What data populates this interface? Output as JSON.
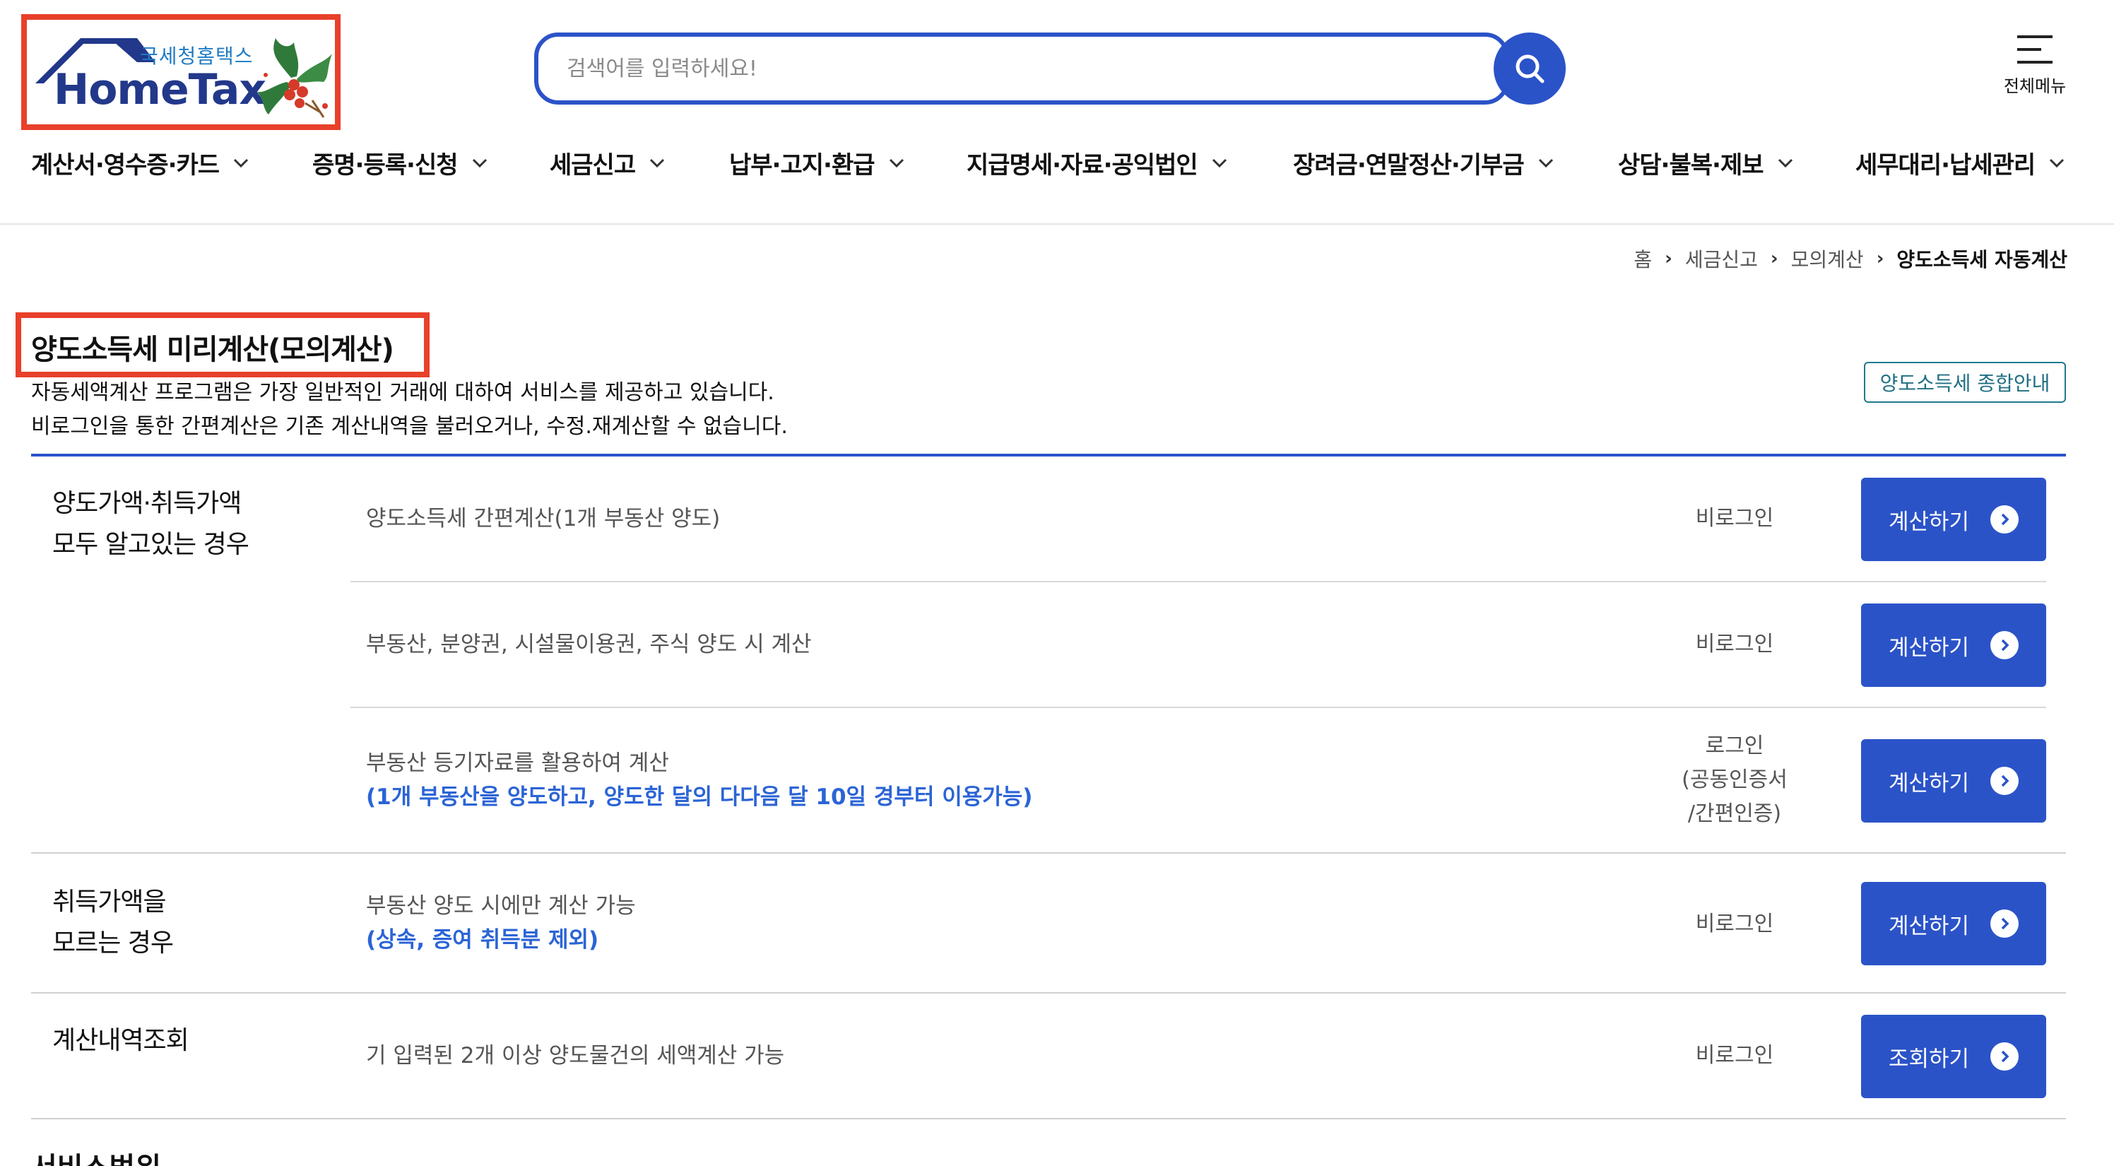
{
  "header": {
    "logo": {
      "subtitle": "국세청홈택스",
      "title": "HomeTax"
    },
    "search": {
      "placeholder": "검색어를 입력하세요!"
    },
    "menu_label": "전체메뉴",
    "nav": [
      {
        "label": "계산서·영수증·카드"
      },
      {
        "label": "증명·등록·신청"
      },
      {
        "label": "세금신고"
      },
      {
        "label": "납부·고지·환급"
      },
      {
        "label": "지급명세·자료·공익법인"
      },
      {
        "label": "장려금·연말정산·기부금"
      },
      {
        "label": "상담·불복·제보"
      },
      {
        "label": "세무대리·납세관리"
      }
    ]
  },
  "breadcrumb": {
    "items": [
      "홈",
      "세금신고",
      "모의계산"
    ],
    "current": "양도소득세 자동계산"
  },
  "page": {
    "title": "양도소득세 미리계산(모의계산)",
    "desc1": "자동세액계산 프로그램은 가장 일반적인 거래에 대하여 서비스를 제공하고 있습니다.",
    "desc2": "비로그인을 통한 간편계산은 기존 계산내역을 불러오거나, 수정.재계산할 수 없습니다.",
    "guide_button": "양도소득세 종합안내"
  },
  "groups": [
    {
      "label_lines": [
        "양도가액·취득가액",
        "모두 알고있는 경우"
      ],
      "items": [
        {
          "desc": "양도소득세 간편계산(1개 부동산 양도)",
          "note": "",
          "login": [
            "비로그인"
          ],
          "button": "계산하기"
        },
        {
          "desc": "부동산, 분양권, 시설물이용권, 주식 양도 시 계산",
          "note": "",
          "login": [
            "비로그인"
          ],
          "button": "계산하기"
        },
        {
          "desc": "부동산 등기자료를 활용하여 계산",
          "note": "(1개 부동산을 양도하고, 양도한 달의 다다음 달 10일 경부터 이용가능)",
          "login": [
            "로그인",
            "(공동인증서",
            "/간편인증)"
          ],
          "button": "계산하기"
        }
      ]
    },
    {
      "label_lines": [
        "취득가액을",
        "모르는 경우"
      ],
      "items": [
        {
          "desc": "부동산 양도 시에만 계산 가능",
          "note": "(상속, 증여 취득분 제외)",
          "login": [
            "비로그인"
          ],
          "button": "계산하기"
        }
      ]
    },
    {
      "label_lines": [
        "계산내역조회"
      ],
      "items": [
        {
          "desc": "기 입력된 2개 이상 양도물건의 세액계산 가능",
          "note": "",
          "login": [
            "비로그인"
          ],
          "button": "조회하기"
        }
      ]
    }
  ],
  "next_section_heading": "서비스범위",
  "colors": {
    "primary": "#2b53c8",
    "highlight_border": "#e8402a",
    "note_text": "#2b64d6",
    "guide_border": "#1f7a8c"
  }
}
